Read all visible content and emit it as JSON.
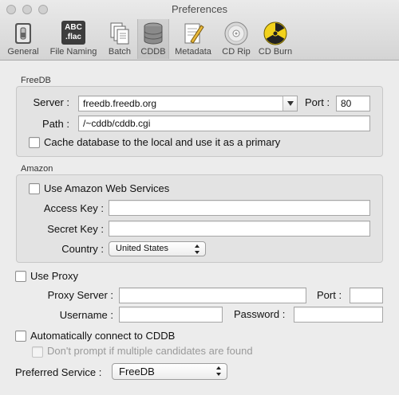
{
  "window": {
    "title": "Preferences"
  },
  "toolbar": {
    "items": [
      {
        "label": "General",
        "icon": "general-switch-icon"
      },
      {
        "label": "File Naming",
        "icon": "abc-flac-icon",
        "icon_text_top": "ABC",
        "icon_text_bottom": ".flac"
      },
      {
        "label": "Batch",
        "icon": "batch-documents-icon"
      },
      {
        "label": "CDDB",
        "icon": "database-icon",
        "selected": true
      },
      {
        "label": "Metadata",
        "icon": "pencil-document-icon"
      },
      {
        "label": "CD Rip",
        "icon": "cd-disc-icon"
      },
      {
        "label": "CD Burn",
        "icon": "radiation-icon"
      }
    ]
  },
  "freedb": {
    "section_label": "FreeDB",
    "server_label": "Server :",
    "server_value": "freedb.freedb.org",
    "port_label": "Port :",
    "port_value": "80",
    "path_label": "Path :",
    "path_value": "/~cddb/cddb.cgi",
    "cache_label": "Cache database to the local and use it as a primary"
  },
  "amazon": {
    "section_label": "Amazon",
    "use_label": "Use Amazon Web Services",
    "access_key_label": "Access Key :",
    "access_key_value": "",
    "secret_key_label": "Secret Key :",
    "secret_key_value": "",
    "country_label": "Country :",
    "country_value": "United States"
  },
  "proxy": {
    "use_label": "Use Proxy",
    "server_label": "Proxy Server :",
    "server_value": "",
    "port_label": "Port :",
    "port_value": "",
    "username_label": "Username :",
    "username_value": "",
    "password_label": "Password :",
    "password_value": ""
  },
  "auto": {
    "connect_label": "Automatically connect to CDDB",
    "noprompt_label": "Don't prompt if multiple candidates are found"
  },
  "preferred": {
    "label": "Preferred Service :",
    "value": "FreeDB"
  },
  "colors": {
    "window_bg": "#ececec",
    "group_bg": "#e3e3e3",
    "toolbar_gradient_top": "#eaeaea",
    "toolbar_gradient_bottom": "#d4d4d4"
  }
}
